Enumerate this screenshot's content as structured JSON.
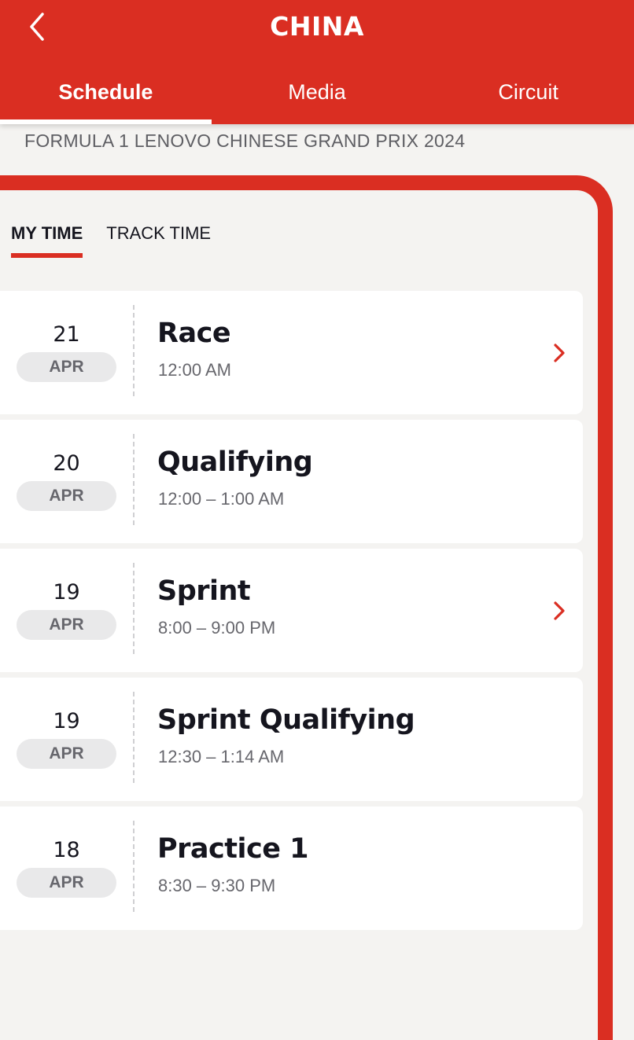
{
  "header": {
    "title": "CHINA",
    "back_icon": "chevron-left-icon"
  },
  "tabs": [
    {
      "label": "Schedule",
      "active": true
    },
    {
      "label": "Media",
      "active": false
    },
    {
      "label": "Circuit",
      "active": false
    }
  ],
  "event_title": "FORMULA 1 LENOVO CHINESE GRAND PRIX 2024",
  "time_toggle": [
    {
      "label": "MY TIME",
      "active": true
    },
    {
      "label": "TRACK TIME",
      "active": false
    }
  ],
  "sessions": [
    {
      "day": "21",
      "month": "APR",
      "name": "Race",
      "time": "12:00 AM",
      "has_chevron": true
    },
    {
      "day": "20",
      "month": "APR",
      "name": "Qualifying",
      "time": "12:00 – 1:00 AM",
      "has_chevron": false
    },
    {
      "day": "19",
      "month": "APR",
      "name": "Sprint",
      "time": "8:00 – 9:00 PM",
      "has_chevron": true
    },
    {
      "day": "19",
      "month": "APR",
      "name": "Sprint Qualifying",
      "time": "12:30 – 1:14 AM",
      "has_chevron": false
    },
    {
      "day": "18",
      "month": "APR",
      "name": "Practice 1",
      "time": "8:30 – 9:30 PM",
      "has_chevron": false
    }
  ],
  "colors": {
    "brand_red": "#da2e22",
    "background": "#f4f3f1",
    "text_dark": "#15151e",
    "text_muted": "#67676d"
  }
}
